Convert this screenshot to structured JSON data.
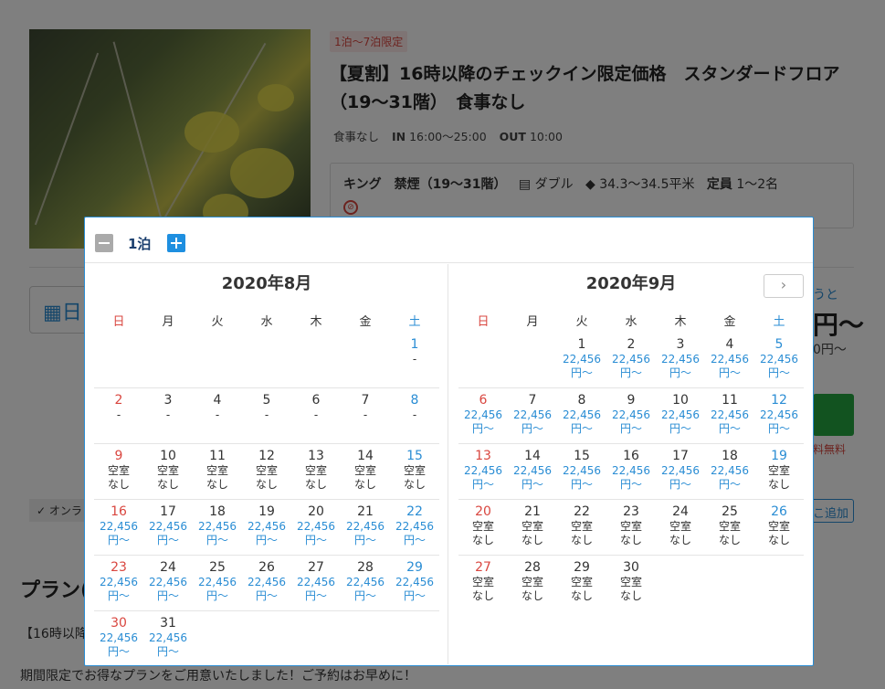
{
  "plan": {
    "stay_badge": "1泊～7泊限定",
    "title": "【夏割】16時以降のチェックイン限定価格　スタンダードフロア（19～31階）　食事なし",
    "meal": "食事なし",
    "in_label": "IN",
    "in_time": "16:00～25:00",
    "out_label": "OUT",
    "out_time": "10:00"
  },
  "room": {
    "type": "キング　禁煙（19～31階）",
    "bed": "ダブル",
    "size": "34.3～34.5平米",
    "capacity_label": "定員",
    "capacity": "1～2名"
  },
  "background": {
    "date_field": "日",
    "right_help": "うと",
    "right_price": "円～",
    "right_price2": "0円～",
    "cancel": "料無料",
    "online": "✓ オンラ",
    "add": "こ追加",
    "plan_heading": "プラン(",
    "plan_sub": "【16時以降",
    "plan_desc": "期間限定でお得なプランをご用意いたしました！ご予約はお早めに！"
  },
  "calendar": {
    "nights": "1泊",
    "next_icon": "chevron-right-icon",
    "weekdays": [
      "日",
      "月",
      "火",
      "水",
      "木",
      "金",
      "土"
    ],
    "months": [
      {
        "title": "2020年8月",
        "first_weekday": 6,
        "days": [
          {
            "d": "1",
            "info": [
              "-"
            ]
          },
          {
            "d": "2",
            "info": [
              "-"
            ]
          },
          {
            "d": "3",
            "info": [
              "-"
            ]
          },
          {
            "d": "4",
            "info": [
              "-"
            ]
          },
          {
            "d": "5",
            "info": [
              "-"
            ]
          },
          {
            "d": "6",
            "info": [
              "-"
            ]
          },
          {
            "d": "7",
            "info": [
              "-"
            ]
          },
          {
            "d": "8",
            "info": [
              "-"
            ]
          },
          {
            "d": "9",
            "info": [
              "空室",
              "なし"
            ]
          },
          {
            "d": "10",
            "info": [
              "空室",
              "なし"
            ]
          },
          {
            "d": "11",
            "info": [
              "空室",
              "なし"
            ]
          },
          {
            "d": "12",
            "info": [
              "空室",
              "なし"
            ]
          },
          {
            "d": "13",
            "info": [
              "空室",
              "なし"
            ]
          },
          {
            "d": "14",
            "info": [
              "空室",
              "なし"
            ]
          },
          {
            "d": "15",
            "info": [
              "空室",
              "なし"
            ]
          },
          {
            "d": "16",
            "info": [
              "22,456",
              "円～"
            ],
            "price": true
          },
          {
            "d": "17",
            "info": [
              "22,456",
              "円～"
            ],
            "price": true
          },
          {
            "d": "18",
            "info": [
              "22,456",
              "円～"
            ],
            "price": true
          },
          {
            "d": "19",
            "info": [
              "22,456",
              "円～"
            ],
            "price": true
          },
          {
            "d": "20",
            "info": [
              "22,456",
              "円～"
            ],
            "price": true
          },
          {
            "d": "21",
            "info": [
              "22,456",
              "円～"
            ],
            "price": true
          },
          {
            "d": "22",
            "info": [
              "22,456",
              "円～"
            ],
            "price": true
          },
          {
            "d": "23",
            "info": [
              "22,456",
              "円～"
            ],
            "price": true
          },
          {
            "d": "24",
            "info": [
              "22,456",
              "円～"
            ],
            "price": true
          },
          {
            "d": "25",
            "info": [
              "22,456",
              "円～"
            ],
            "price": true
          },
          {
            "d": "26",
            "info": [
              "22,456",
              "円～"
            ],
            "price": true
          },
          {
            "d": "27",
            "info": [
              "22,456",
              "円～"
            ],
            "price": true
          },
          {
            "d": "28",
            "info": [
              "22,456",
              "円～"
            ],
            "price": true
          },
          {
            "d": "29",
            "info": [
              "22,456",
              "円～"
            ],
            "price": true
          },
          {
            "d": "30",
            "info": [
              "22,456",
              "円～"
            ],
            "price": true
          },
          {
            "d": "31",
            "info": [
              "22,456",
              "円～"
            ],
            "price": true
          }
        ]
      },
      {
        "title": "2020年9月",
        "first_weekday": 2,
        "days": [
          {
            "d": "1",
            "info": [
              "22,456",
              "円～"
            ],
            "price": true
          },
          {
            "d": "2",
            "info": [
              "22,456",
              "円～"
            ],
            "price": true
          },
          {
            "d": "3",
            "info": [
              "22,456",
              "円～"
            ],
            "price": true
          },
          {
            "d": "4",
            "info": [
              "22,456",
              "円～"
            ],
            "price": true
          },
          {
            "d": "5",
            "info": [
              "22,456",
              "円～"
            ],
            "price": true
          },
          {
            "d": "6",
            "info": [
              "22,456",
              "円～"
            ],
            "price": true
          },
          {
            "d": "7",
            "info": [
              "22,456",
              "円～"
            ],
            "price": true
          },
          {
            "d": "8",
            "info": [
              "22,456",
              "円～"
            ],
            "price": true
          },
          {
            "d": "9",
            "info": [
              "22,456",
              "円～"
            ],
            "price": true
          },
          {
            "d": "10",
            "info": [
              "22,456",
              "円～"
            ],
            "price": true
          },
          {
            "d": "11",
            "info": [
              "22,456",
              "円～"
            ],
            "price": true
          },
          {
            "d": "12",
            "info": [
              "22,456",
              "円～"
            ],
            "price": true
          },
          {
            "d": "13",
            "info": [
              "22,456",
              "円～"
            ],
            "price": true
          },
          {
            "d": "14",
            "info": [
              "22,456",
              "円～"
            ],
            "price": true
          },
          {
            "d": "15",
            "info": [
              "22,456",
              "円～"
            ],
            "price": true
          },
          {
            "d": "16",
            "info": [
              "22,456",
              "円～"
            ],
            "price": true
          },
          {
            "d": "17",
            "info": [
              "22,456",
              "円～"
            ],
            "price": true
          },
          {
            "d": "18",
            "info": [
              "22,456",
              "円～"
            ],
            "price": true
          },
          {
            "d": "19",
            "info": [
              "空室",
              "なし"
            ]
          },
          {
            "d": "20",
            "info": [
              "空室",
              "なし"
            ]
          },
          {
            "d": "21",
            "info": [
              "空室",
              "なし"
            ]
          },
          {
            "d": "22",
            "info": [
              "空室",
              "なし"
            ]
          },
          {
            "d": "23",
            "info": [
              "空室",
              "なし"
            ]
          },
          {
            "d": "24",
            "info": [
              "空室",
              "なし"
            ]
          },
          {
            "d": "25",
            "info": [
              "空室",
              "なし"
            ]
          },
          {
            "d": "26",
            "info": [
              "空室",
              "なし"
            ]
          },
          {
            "d": "27",
            "info": [
              "空室",
              "なし"
            ]
          },
          {
            "d": "28",
            "info": [
              "空室",
              "なし"
            ]
          },
          {
            "d": "29",
            "info": [
              "空室",
              "なし"
            ]
          },
          {
            "d": "30",
            "info": [
              "空室",
              "なし"
            ]
          }
        ]
      }
    ]
  },
  "colors": {
    "sunday": "#d9463f",
    "saturday": "#2a8dd4",
    "price": "#2a8dd4",
    "accent": "#1e8fe0"
  }
}
